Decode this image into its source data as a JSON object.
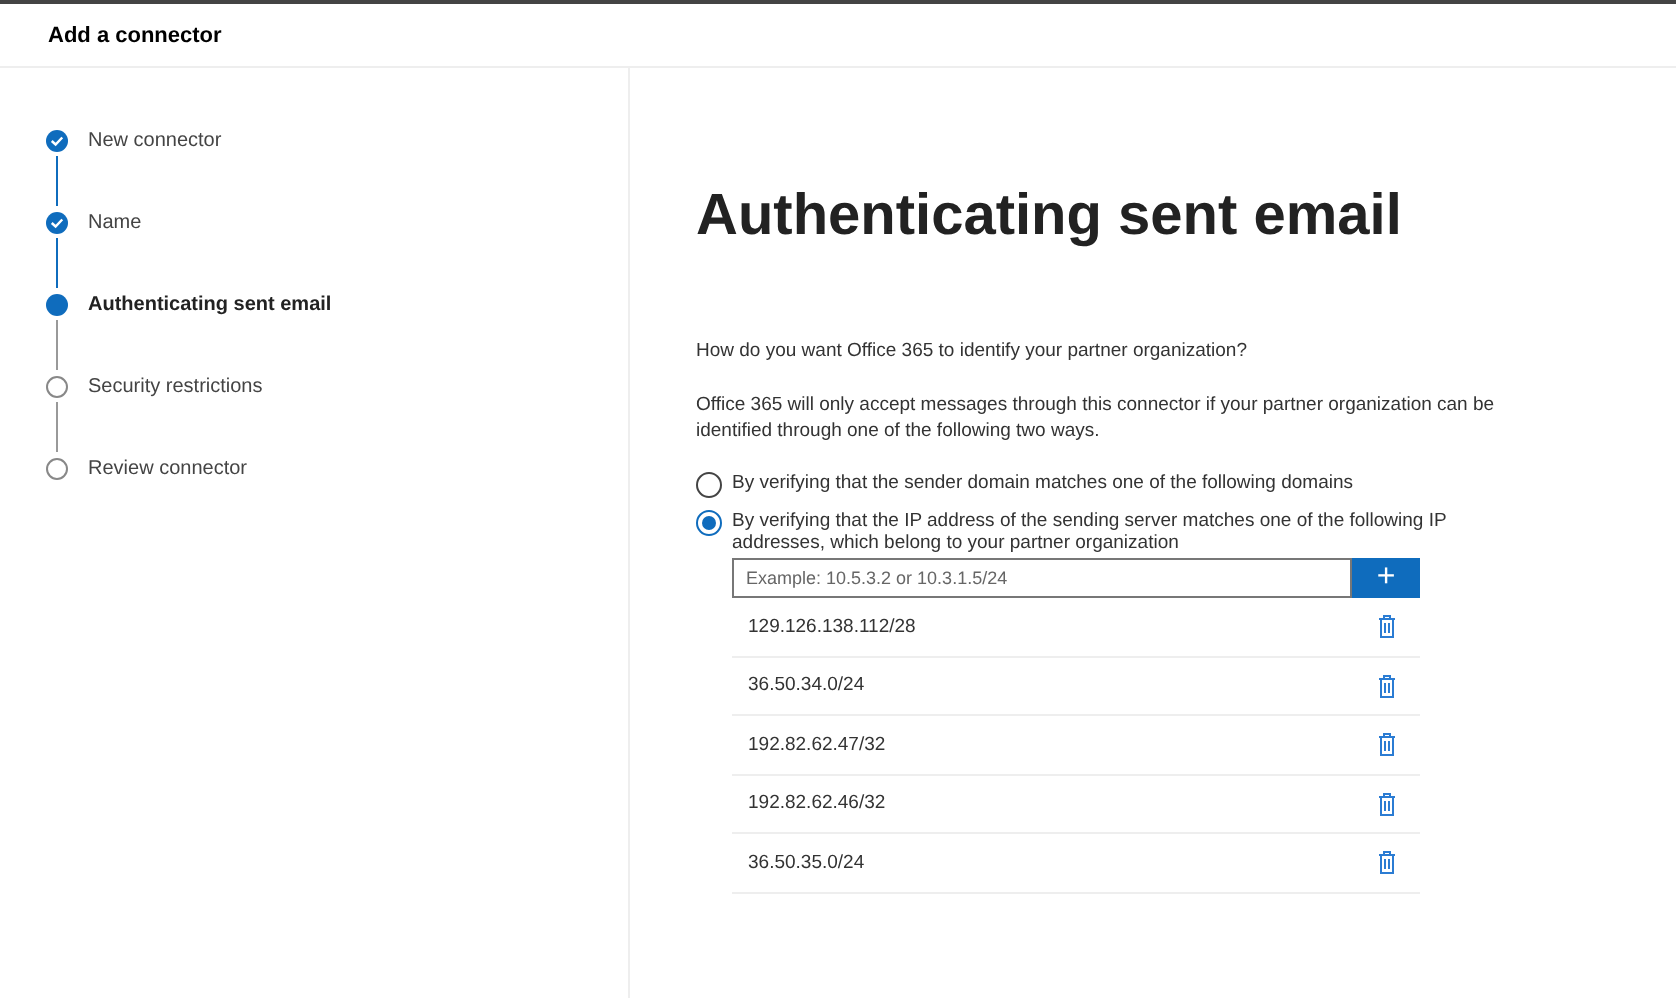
{
  "window": {
    "title": "Add a connector"
  },
  "steps": [
    {
      "label": "New connector",
      "kind": "done"
    },
    {
      "label": "Name",
      "kind": "done"
    },
    {
      "label": "Authenticating sent email",
      "kind": "current"
    },
    {
      "label": "Security restrictions",
      "kind": "pending"
    },
    {
      "label": "Review connector",
      "kind": "pending"
    }
  ],
  "heading": "Authenticating sent email",
  "question": "How do you want Office 365 to identify your partner organization?",
  "description": "Office 365 will only accept messages through this connector if your partner organization can be identified through one of the following two ways.",
  "options": [
    {
      "label": "By verifying that the sender domain matches one of the following domains",
      "selected": false
    },
    {
      "label": "By verifying that the IP address of the sending server matches one of the following IP addresses, which belong to your partner organization",
      "selected": true
    }
  ],
  "ip_input": {
    "placeholder": "Example: 10.5.3.2 or 10.3.1.5/24",
    "add_button": "+"
  },
  "ip_addresses": [
    "129.126.138.112/28",
    "36.50.34.0/24",
    "192.82.62.47/32",
    "192.82.62.46/32",
    "36.50.35.0/24"
  ]
}
